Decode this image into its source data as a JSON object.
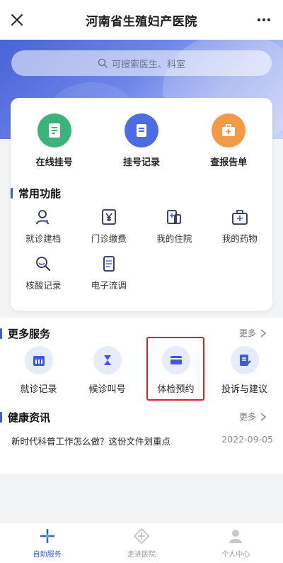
{
  "header": {
    "title": "河南省生殖妇产医院"
  },
  "search": {
    "placeholder": "可搜索医生、科室"
  },
  "quick_actions": [
    {
      "label": "在线挂号",
      "icon": "register-card-icon",
      "color": "#3bb37b"
    },
    {
      "label": "挂号记录",
      "icon": "record-scroll-icon",
      "color": "#4d6be5"
    },
    {
      "label": "查报告单",
      "icon": "medical-kit-icon",
      "color": "#f29a45"
    }
  ],
  "common": {
    "title": "常用功能",
    "items": [
      {
        "label": "就诊建档",
        "icon": "user-profile-icon"
      },
      {
        "label": "门诊缴费",
        "icon": "yen-payment-icon"
      },
      {
        "label": "我的住院",
        "icon": "hospital-bed-icon"
      },
      {
        "label": "我的药物",
        "icon": "medicine-box-icon"
      },
      {
        "label": "核酸记录",
        "icon": "magnifier-icon"
      },
      {
        "label": "电子流调",
        "icon": "document-icon"
      }
    ]
  },
  "more_services": {
    "title": "更多服务",
    "more_label": "更多",
    "items": [
      {
        "label": "就诊记录",
        "icon": "calendar-icon"
      },
      {
        "label": "候诊叫号",
        "icon": "hourglass-icon"
      },
      {
        "label": "体检预约",
        "icon": "wallet-icon"
      },
      {
        "label": "投诉与建议",
        "icon": "edit-document-icon"
      }
    ]
  },
  "health_news": {
    "title": "健康资讯",
    "more_label": "更多",
    "items": [
      {
        "title": "新时代科普工作怎么做？这份文件划重点",
        "date": "2022-09-05"
      }
    ]
  },
  "tabbar": [
    {
      "label": "自助服务",
      "icon": "self-service-icon",
      "active": true
    },
    {
      "label": "走进医院",
      "icon": "hospital-logo-icon",
      "active": false
    },
    {
      "label": "个人中心",
      "icon": "person-icon",
      "active": false
    }
  ],
  "colors": {
    "accent": "#3b5bdb",
    "highlight": "#e02020"
  }
}
